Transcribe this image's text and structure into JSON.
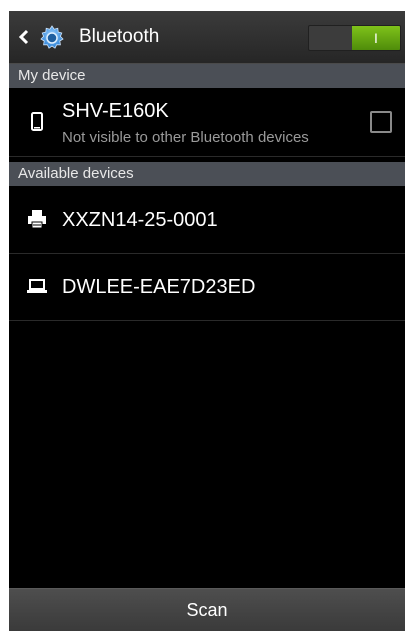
{
  "header": {
    "title": "Bluetooth",
    "back_icon": "chevron-left-icon",
    "app_icon": "gear-icon",
    "toggle_label": "I",
    "toggle_state": "on",
    "accent_color": "#6aac14"
  },
  "my_device": {
    "section_label": "My device",
    "name": "SHV-E160K",
    "subtitle": "Not visible to other Bluetooth devices",
    "icon": "phone-icon",
    "visible_checked": false
  },
  "available": {
    "section_label": "Available devices",
    "devices": [
      {
        "name": "XXZN14-25-0001",
        "icon": "printer-icon"
      },
      {
        "name": "DWLEE-EAE7D23ED",
        "icon": "laptop-icon"
      }
    ]
  },
  "footer": {
    "scan_label": "Scan"
  }
}
